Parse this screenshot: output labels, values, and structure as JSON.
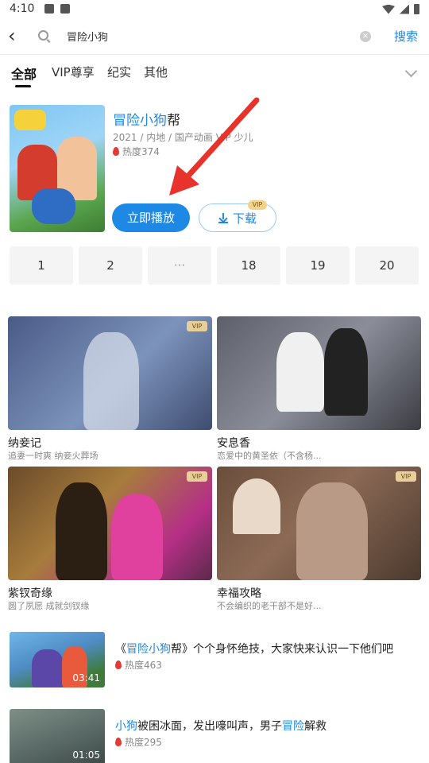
{
  "status": {
    "time": "4:10"
  },
  "search": {
    "query": "冒险小狗",
    "button": "搜索"
  },
  "tabs": [
    "全部",
    "VIP尊享",
    "纪实",
    "其他"
  ],
  "show": {
    "title_highlight": "冒险小狗",
    "title_rest": "帮",
    "meta": "2021 / 内地 / 国产动画  VIP 少儿",
    "heat": "热度374",
    "play_label": "立即播放",
    "download_label": "下载",
    "vip_badge": "VIP"
  },
  "episodes": [
    "1",
    "2",
    "···",
    "18",
    "19",
    "20"
  ],
  "recommendations": [
    {
      "title": "纳妾记",
      "subtitle": "追妻一时爽 纳妾火葬场",
      "badge": "VIP"
    },
    {
      "title": "安息香",
      "subtitle": "恋爱中的黄圣依（不含杨...",
      "badge": "VIP"
    },
    {
      "title": "紫钗奇缘",
      "subtitle": "圆了夙愿    成就剑钗缘",
      "badge": "VIP"
    },
    {
      "title": "幸福攻略",
      "subtitle": "不会编织的老干部不是好...",
      "badge": "VIP"
    }
  ],
  "videos": [
    {
      "prefix": "《",
      "highlight": "冒险小狗",
      "rest": "帮》个个身怀绝技，大家快来认识一下他们吧",
      "heat": "热度463",
      "duration": "03:41"
    },
    {
      "prefix": "",
      "highlight": "小狗",
      "rest": "被困冰面，发出嚎叫声，男子",
      "highlight2": "冒险",
      "rest2": "解救",
      "heat": "热度295",
      "duration": "01:05"
    }
  ],
  "colors": {
    "accent": "#1e88e5",
    "heat": "#e53935",
    "vip": "#e6cf9a"
  }
}
